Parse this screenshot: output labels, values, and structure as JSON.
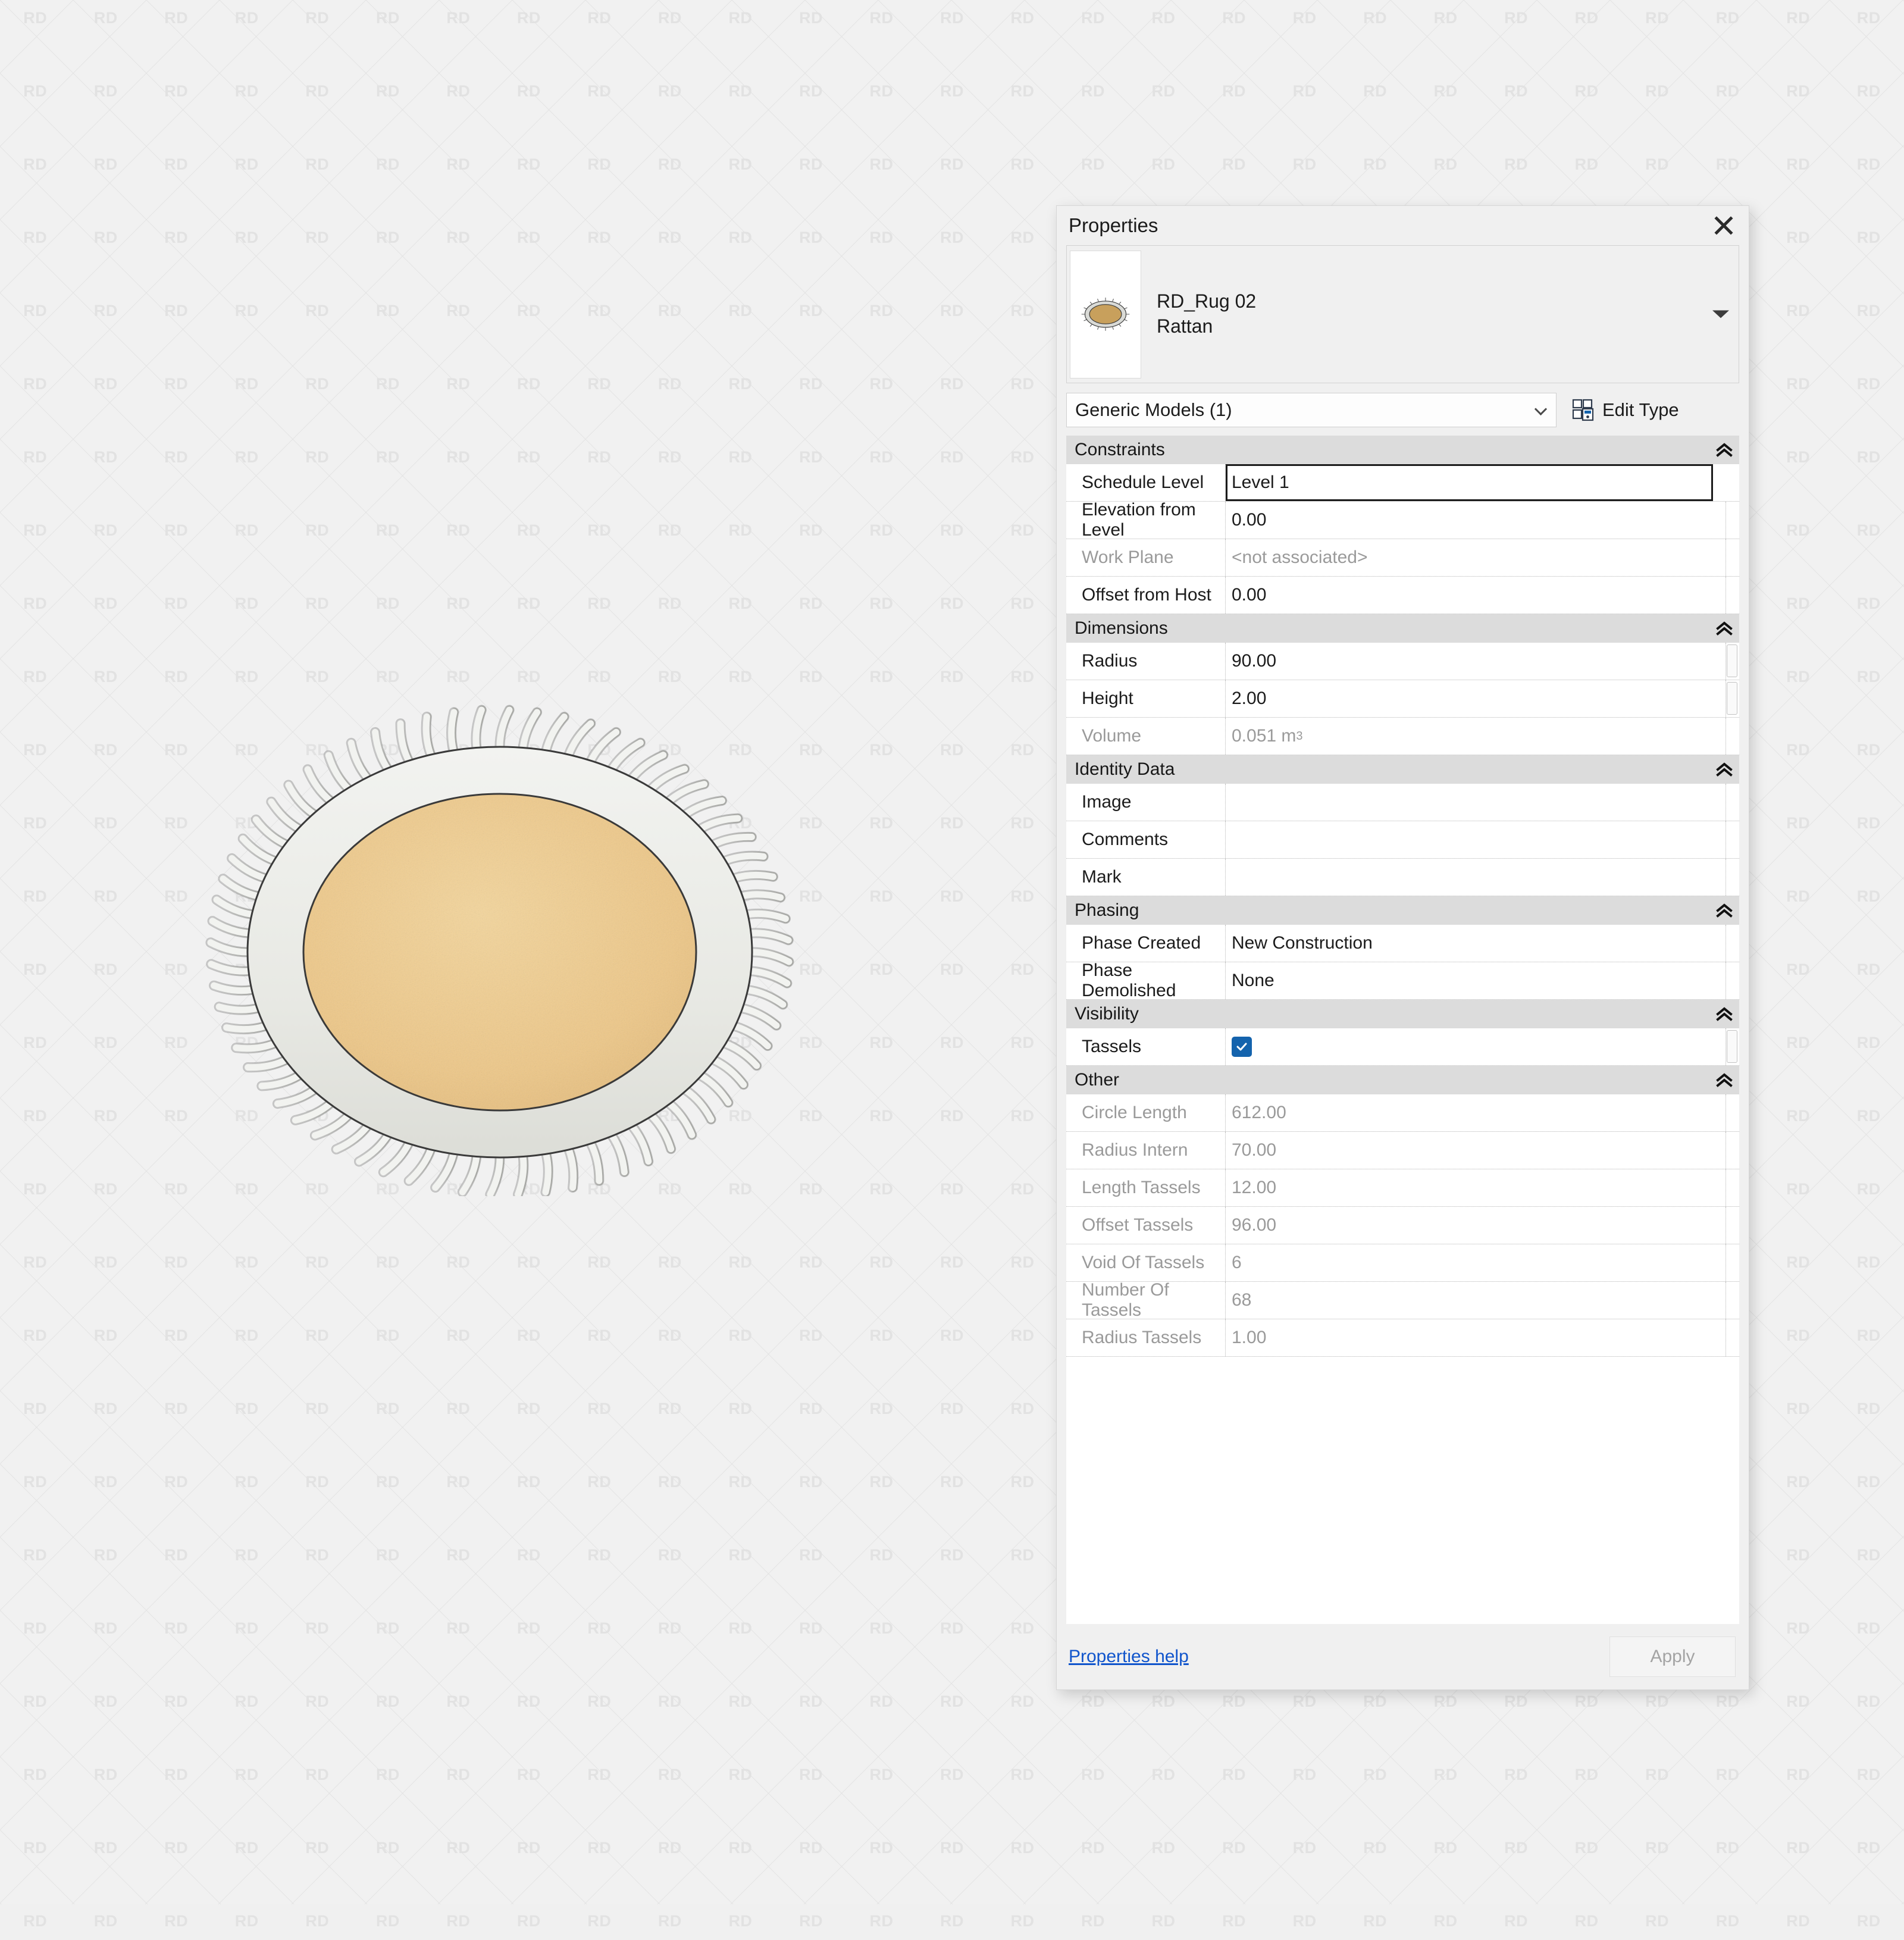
{
  "watermark": {
    "text": "RD"
  },
  "panel": {
    "title": "Properties",
    "close_icon": "close-icon",
    "preview": {
      "name": "RD_Rug 02",
      "type": "Rattan",
      "caret_icon": "chevron-down-icon"
    },
    "type_selector": {
      "value": "Generic Models (1)",
      "caret_icon": "chevron-down-icon"
    },
    "edit_type": {
      "label": "Edit Type",
      "icon": "edit-type-icon"
    },
    "groups": [
      {
        "title": "Constraints",
        "collapse_icon": "double-chevron-up-icon",
        "rows": [
          {
            "name": "Schedule Level",
            "value": "Level 1",
            "dim": false,
            "value_dim": false,
            "active": true,
            "spinner": false,
            "checkbox": null
          },
          {
            "name": "Elevation from Level",
            "value": "0.00",
            "dim": false,
            "value_dim": false,
            "active": false,
            "spinner": false,
            "checkbox": null
          },
          {
            "name": "Work Plane",
            "value": "<not associated>",
            "dim": true,
            "value_dim": true,
            "active": false,
            "spinner": false,
            "checkbox": null
          },
          {
            "name": "Offset from Host",
            "value": "0.00",
            "dim": false,
            "value_dim": false,
            "active": false,
            "spinner": false,
            "checkbox": null
          }
        ]
      },
      {
        "title": "Dimensions",
        "collapse_icon": "double-chevron-up-icon",
        "rows": [
          {
            "name": "Radius",
            "value": "90.00",
            "dim": false,
            "value_dim": false,
            "active": false,
            "spinner": true,
            "checkbox": null
          },
          {
            "name": "Height",
            "value": "2.00",
            "dim": false,
            "value_dim": false,
            "active": false,
            "spinner": true,
            "checkbox": null
          },
          {
            "name": "Volume",
            "value": "0.051 m",
            "superscript": "3",
            "dim": true,
            "value_dim": true,
            "active": false,
            "spinner": false,
            "checkbox": null
          }
        ]
      },
      {
        "title": "Identity Data",
        "collapse_icon": "double-chevron-up-icon",
        "rows": [
          {
            "name": "Image",
            "value": "",
            "dim": false,
            "value_dim": false,
            "active": false,
            "spinner": false,
            "checkbox": null
          },
          {
            "name": "Comments",
            "value": "",
            "dim": false,
            "value_dim": false,
            "active": false,
            "spinner": false,
            "checkbox": null
          },
          {
            "name": "Mark",
            "value": "",
            "dim": false,
            "value_dim": false,
            "active": false,
            "spinner": false,
            "checkbox": null
          }
        ]
      },
      {
        "title": "Phasing",
        "collapse_icon": "double-chevron-up-icon",
        "rows": [
          {
            "name": "Phase Created",
            "value": "New Construction",
            "dim": false,
            "value_dim": false,
            "active": false,
            "spinner": false,
            "checkbox": null
          },
          {
            "name": "Phase Demolished",
            "value": "None",
            "dim": false,
            "value_dim": false,
            "active": false,
            "spinner": false,
            "checkbox": null
          }
        ]
      },
      {
        "title": "Visibility",
        "collapse_icon": "double-chevron-up-icon",
        "rows": [
          {
            "name": "Tassels",
            "value": "",
            "dim": false,
            "value_dim": false,
            "active": false,
            "spinner": true,
            "checkbox": true
          }
        ]
      },
      {
        "title": "Other",
        "collapse_icon": "double-chevron-up-icon",
        "rows": [
          {
            "name": "Circle Length",
            "value": "612.00",
            "dim": true,
            "value_dim": true,
            "active": false,
            "spinner": false,
            "checkbox": null
          },
          {
            "name": "Radius Intern",
            "value": "70.00",
            "dim": true,
            "value_dim": true,
            "active": false,
            "spinner": false,
            "checkbox": null
          },
          {
            "name": "Length Tassels",
            "value": "12.00",
            "dim": true,
            "value_dim": true,
            "active": false,
            "spinner": false,
            "checkbox": null
          },
          {
            "name": "Offset Tassels",
            "value": "96.00",
            "dim": true,
            "value_dim": true,
            "active": false,
            "spinner": false,
            "checkbox": null
          },
          {
            "name": "Void Of Tassels",
            "value": "6",
            "dim": true,
            "value_dim": true,
            "active": false,
            "spinner": false,
            "checkbox": null
          },
          {
            "name": "Number Of Tassels",
            "value": "68",
            "dim": true,
            "value_dim": true,
            "active": false,
            "spinner": false,
            "checkbox": null
          },
          {
            "name": "Radius Tassels",
            "value": "1.00",
            "dim": true,
            "value_dim": true,
            "active": false,
            "spinner": false,
            "checkbox": null
          }
        ]
      }
    ],
    "footer": {
      "help_label": "Properties help",
      "apply_label": "Apply"
    }
  },
  "model": {
    "name": "rug-round-with-tassels",
    "tassel_count": 68,
    "colors": {
      "rug_border": "#e7e8e3",
      "rug_field": "#eec98a",
      "tassel": "#e9eae6",
      "outline": "#3a3a3a",
      "accent_blue": "#1463ad",
      "link_blue": "#1155cc"
    }
  }
}
